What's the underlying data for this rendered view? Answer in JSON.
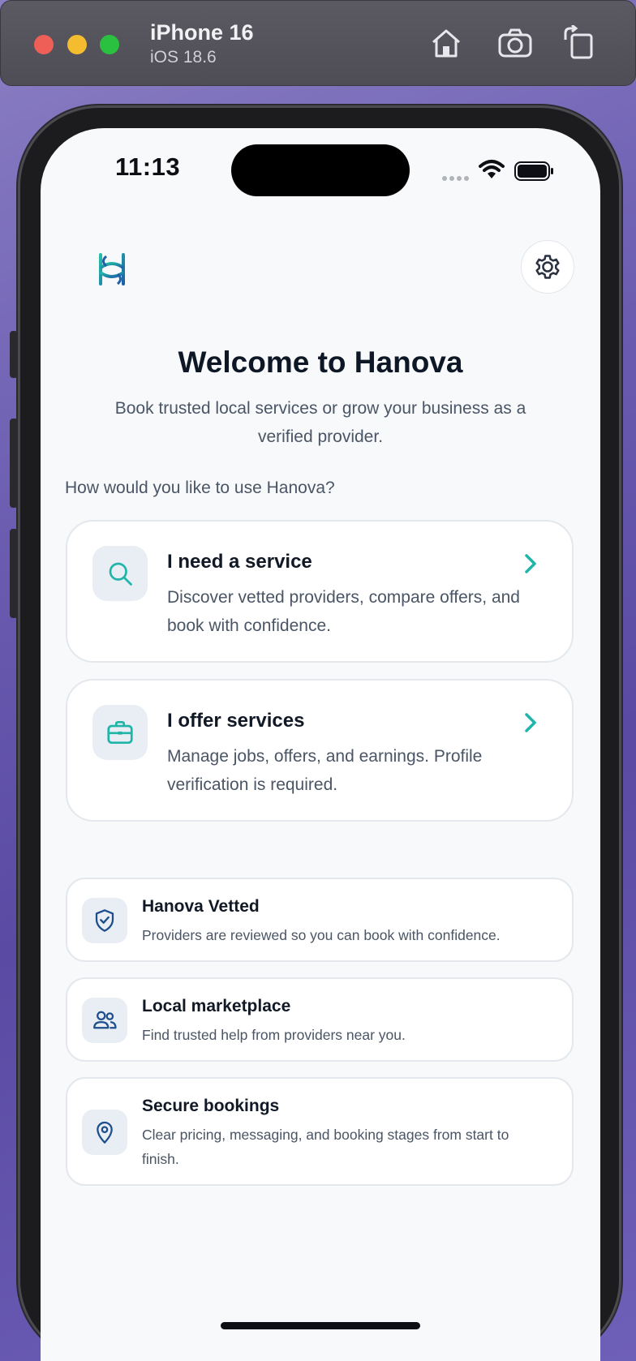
{
  "simulator": {
    "device_name": "iPhone 16",
    "os_version": "iOS 18.6",
    "toolbar_icons": [
      "home-icon",
      "screenshot-camera-icon",
      "rotate-icon"
    ]
  },
  "status_bar": {
    "time": "11:13",
    "icons": [
      "cellular-signal-icon",
      "wifi-icon",
      "battery-icon"
    ]
  },
  "header": {
    "logo_icon": "hanova-logo-icon",
    "settings_icon": "gear-icon"
  },
  "welcome": {
    "title": "Welcome to Hanova",
    "subtitle": "Book trusted local services or grow your business as a verified provider."
  },
  "role_prompt": "How would you like to use Hanova?",
  "roles": [
    {
      "title": "I need a service",
      "description": "Discover vetted providers, compare offers, and book with confidence.",
      "icon": "search-icon"
    },
    {
      "title": "I offer services",
      "description": "Manage jobs, offers, and earnings. Profile verification is required.",
      "icon": "briefcase-icon"
    }
  ],
  "features": [
    {
      "title": "Hanova Vetted",
      "description": "Providers are reviewed so you can book with confidence.",
      "icon": "shield-check-icon"
    },
    {
      "title": "Local marketplace",
      "description": "Find trusted help from providers near you.",
      "icon": "people-icon"
    },
    {
      "title": "Secure bookings",
      "description": "Clear pricing, messaging, and booking stages from start to finish.",
      "icon": "location-pin-icon"
    }
  ],
  "colors": {
    "accent_teal": "#1fb5a8",
    "navy_icon": "#1e4f8c",
    "title_text": "#0e1726",
    "body_text": "#4a5565"
  }
}
